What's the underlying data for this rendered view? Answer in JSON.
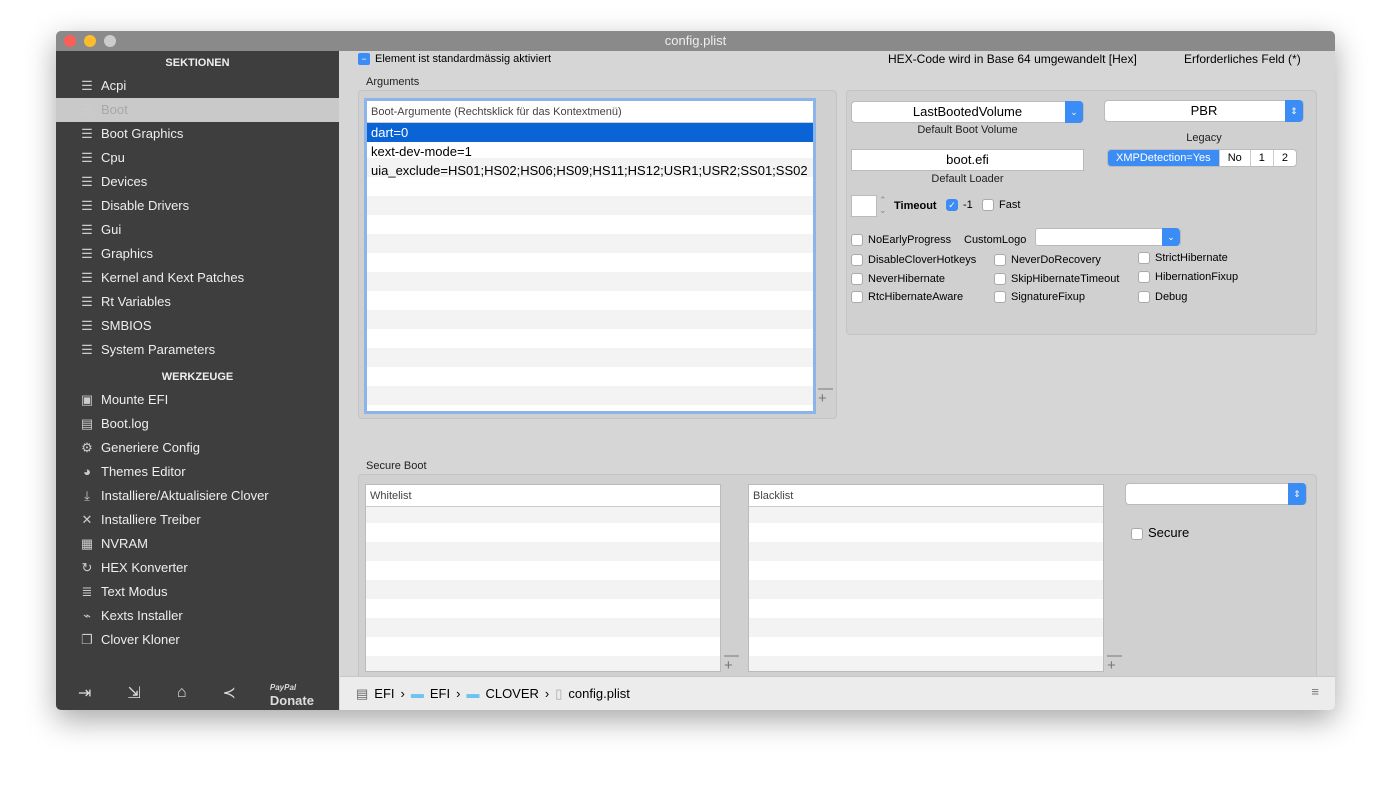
{
  "window": {
    "title": "config.plist"
  },
  "sidebar": {
    "sections_header": "SEKTIONEN",
    "sections": [
      "Acpi",
      "Boot",
      "Boot Graphics",
      "Cpu",
      "Devices",
      "Disable Drivers",
      "Gui",
      "Graphics",
      "Kernel and Kext Patches",
      "Rt Variables",
      "SMBIOS",
      "System Parameters"
    ],
    "selected": "Boot",
    "tools_header": "WERKZEUGE",
    "tools": [
      {
        "label": "Mounte EFI",
        "icon": "disk-icon"
      },
      {
        "label": "Boot.log",
        "icon": "log-icon"
      },
      {
        "label": "Generiere Config",
        "icon": "gears-icon"
      },
      {
        "label": "Themes Editor",
        "icon": "palette-icon"
      },
      {
        "label": "Installiere/Aktualisiere Clover",
        "icon": "download-icon"
      },
      {
        "label": "Installiere Treiber",
        "icon": "wrench-icon"
      },
      {
        "label": "NVRAM",
        "icon": "chip-icon"
      },
      {
        "label": "HEX Konverter",
        "icon": "refresh-icon"
      },
      {
        "label": "Text Modus",
        "icon": "text-icon"
      },
      {
        "label": "Kexts Installer",
        "icon": "plug-icon"
      },
      {
        "label": "Clover Kloner",
        "icon": "copy-icon"
      }
    ],
    "bottom": {
      "donate": "Donate",
      "paypal": "PayPal"
    }
  },
  "header": {
    "enabled_default": "Element ist standardmässig aktiviert",
    "hex_note": "HEX-Code wird in Base 64 umgewandelt [Hex]",
    "required": "Erforderliches Feld (*)"
  },
  "arguments": {
    "title": "Arguments",
    "column": "Boot-Argumente (Rechtsklick für das Kontextmenü)",
    "rows": [
      "dart=0",
      "kext-dev-mode=1",
      "uia_exclude=HS01;HS02;HS06;HS09;HS11;HS12;USR1;USR2;SS01;SS02"
    ],
    "selected_index": 0
  },
  "boot": {
    "default_volume": "LastBootedVolume",
    "default_volume_label": "Default Boot Volume",
    "legacy_value": "PBR",
    "legacy_label": "Legacy",
    "xmp": [
      "XMPDetection=Yes",
      "No",
      "1",
      "2"
    ],
    "default_loader": "boot.efi",
    "default_loader_label": "Default Loader",
    "timeout_label": "Timeout",
    "timeout_value": "",
    "minus1": "-1",
    "fast": "Fast",
    "custom_logo_label": "CustomLogo",
    "custom_logo_value": "",
    "checks": [
      {
        "label": "NoEarlyProgress",
        "checked": false
      },
      {
        "label": "DisableCloverHotkeys",
        "checked": false
      },
      {
        "label": "NeverDoRecovery",
        "checked": false
      },
      {
        "label": "StrictHibernate",
        "checked": false
      },
      {
        "label": "NeverHibernate",
        "checked": false
      },
      {
        "label": "SkipHibernateTimeout",
        "checked": false
      },
      {
        "label": "HibernationFixup",
        "checked": false
      },
      {
        "label": "RtcHibernateAware",
        "checked": false
      },
      {
        "label": "SignatureFixup",
        "checked": false
      },
      {
        "label": "Debug",
        "checked": false
      }
    ]
  },
  "secure_boot": {
    "title": "Secure Boot",
    "whitelist": "Whitelist",
    "blacklist": "Blacklist",
    "policy_value": "",
    "secure": "Secure"
  },
  "breadcrumb": [
    "EFI",
    "EFI",
    "CLOVER",
    "config.plist"
  ],
  "colors": {
    "accent": "#3b8cf5",
    "sidebar": "#3e3e3e"
  }
}
